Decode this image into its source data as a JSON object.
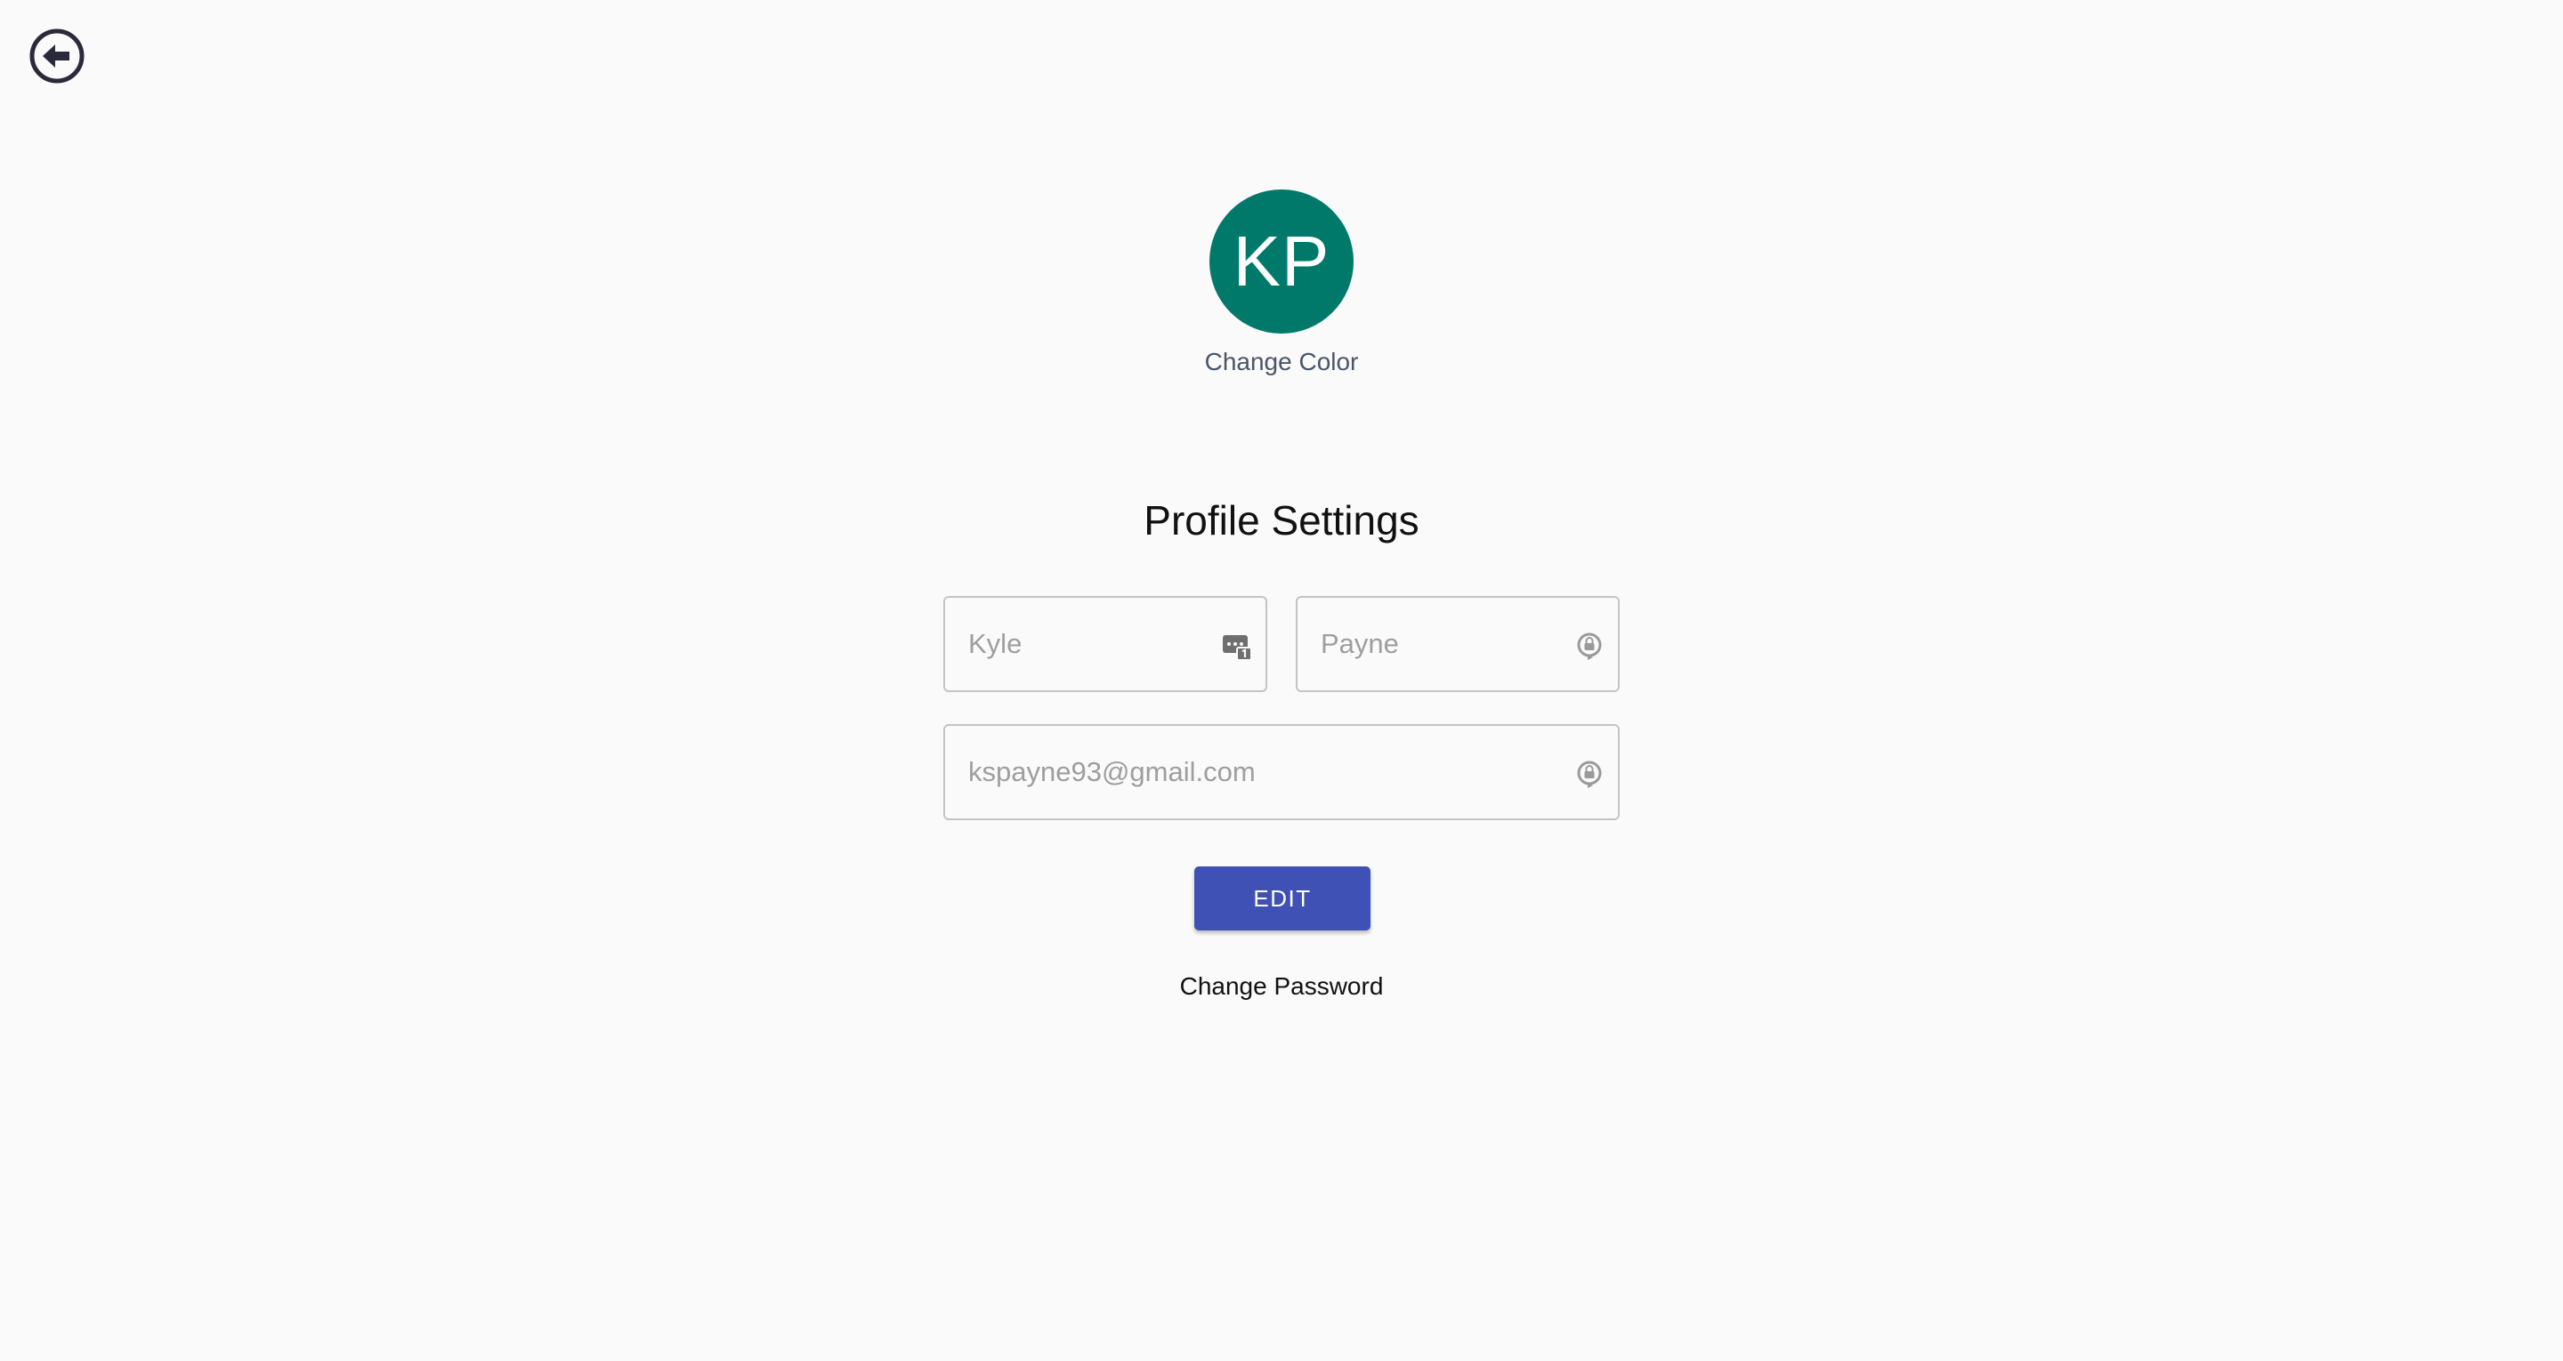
{
  "nav": {
    "back_icon": "arrow-left-circle-icon"
  },
  "avatar": {
    "initials": "KP",
    "color": "#00796b",
    "change_color_label": "Change Color"
  },
  "page_title": "Profile Settings",
  "form": {
    "first_name": {
      "value": "Kyle",
      "icon": "password-manager-icon"
    },
    "last_name": {
      "value": "Payne",
      "icon": "autofill-lock-icon"
    },
    "email": {
      "value": "kspayne93@gmail.com",
      "icon": "autofill-lock-icon"
    },
    "edit_label": "EDIT",
    "edit_color": "#3f51b5"
  },
  "change_password_label": "Change Password"
}
